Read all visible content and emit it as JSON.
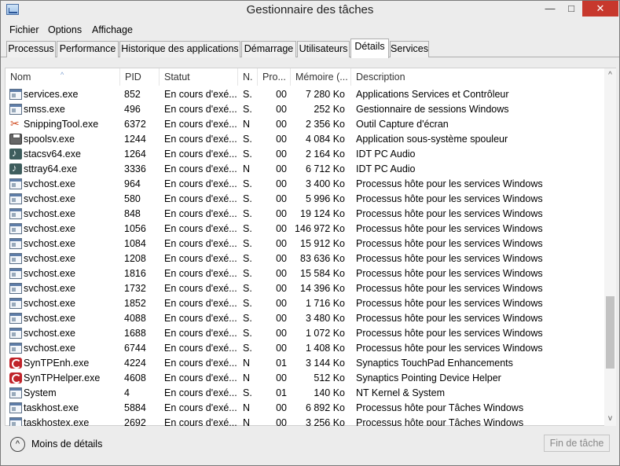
{
  "window": {
    "title": "Gestionnaire des tâches",
    "min_glyph": "—",
    "max_glyph": "□",
    "close_glyph": "✕"
  },
  "menu": [
    "Fichier",
    "Options",
    "Affichage"
  ],
  "tabs": [
    "Processus",
    "Performance",
    "Historique des applications",
    "Démarrage",
    "Utilisateurs",
    "Détails",
    "Services"
  ],
  "active_tab": "Détails",
  "columns": [
    "Nom",
    "PID",
    "Statut",
    "N.",
    "Pro...",
    "Mémoire (...",
    "Description"
  ],
  "sort_glyph": "^",
  "rows": [
    {
      "icon": "window-icon",
      "name": "services.exe",
      "pid": "852",
      "status": "En cours d'exé...",
      "n": "S.",
      "pro": "00",
      "mem": "7 280 Ko",
      "desc": "Applications Services et Contrôleur"
    },
    {
      "icon": "window-icon",
      "name": "smss.exe",
      "pid": "496",
      "status": "En cours d'exé...",
      "n": "S.",
      "pro": "00",
      "mem": "252 Ko",
      "desc": "Gestionnaire de sessions Windows"
    },
    {
      "icon": "scissors-icon",
      "name": "SnippingTool.exe",
      "pid": "6372",
      "status": "En cours d'exé...",
      "n": "N",
      "pro": "00",
      "mem": "2 356 Ko",
      "desc": "Outil Capture d'écran"
    },
    {
      "icon": "printer-icon",
      "name": "spoolsv.exe",
      "pid": "1244",
      "status": "En cours d'exé...",
      "n": "S.",
      "pro": "00",
      "mem": "4 084 Ko",
      "desc": "Application sous-système spouleur"
    },
    {
      "icon": "audio-icon",
      "name": "stacsv64.exe",
      "pid": "1264",
      "status": "En cours d'exé...",
      "n": "S.",
      "pro": "00",
      "mem": "2 164 Ko",
      "desc": "IDT PC Audio"
    },
    {
      "icon": "audio-icon",
      "name": "sttray64.exe",
      "pid": "3336",
      "status": "En cours d'exé...",
      "n": "N",
      "pro": "00",
      "mem": "6 712 Ko",
      "desc": "IDT PC Audio"
    },
    {
      "icon": "window-icon",
      "name": "svchost.exe",
      "pid": "964",
      "status": "En cours d'exé...",
      "n": "S.",
      "pro": "00",
      "mem": "3 400 Ko",
      "desc": "Processus hôte pour les services Windows"
    },
    {
      "icon": "window-icon",
      "name": "svchost.exe",
      "pid": "580",
      "status": "En cours d'exé...",
      "n": "S.",
      "pro": "00",
      "mem": "5 996 Ko",
      "desc": "Processus hôte pour les services Windows"
    },
    {
      "icon": "window-icon",
      "name": "svchost.exe",
      "pid": "848",
      "status": "En cours d'exé...",
      "n": "S.",
      "pro": "00",
      "mem": "19 124 Ko",
      "desc": "Processus hôte pour les services Windows"
    },
    {
      "icon": "window-icon",
      "name": "svchost.exe",
      "pid": "1056",
      "status": "En cours d'exé...",
      "n": "S.",
      "pro": "00",
      "mem": "146 972 Ko",
      "desc": "Processus hôte pour les services Windows"
    },
    {
      "icon": "window-icon",
      "name": "svchost.exe",
      "pid": "1084",
      "status": "En cours d'exé...",
      "n": "S.",
      "pro": "00",
      "mem": "15 912 Ko",
      "desc": "Processus hôte pour les services Windows"
    },
    {
      "icon": "window-icon",
      "name": "svchost.exe",
      "pid": "1208",
      "status": "En cours d'exé...",
      "n": "S.",
      "pro": "00",
      "mem": "83 636 Ko",
      "desc": "Processus hôte pour les services Windows"
    },
    {
      "icon": "window-icon",
      "name": "svchost.exe",
      "pid": "1816",
      "status": "En cours d'exé...",
      "n": "S.",
      "pro": "00",
      "mem": "15 584 Ko",
      "desc": "Processus hôte pour les services Windows"
    },
    {
      "icon": "window-icon",
      "name": "svchost.exe",
      "pid": "1732",
      "status": "En cours d'exé...",
      "n": "S.",
      "pro": "00",
      "mem": "14 396 Ko",
      "desc": "Processus hôte pour les services Windows"
    },
    {
      "icon": "window-icon",
      "name": "svchost.exe",
      "pid": "1852",
      "status": "En cours d'exé...",
      "n": "S.",
      "pro": "00",
      "mem": "1 716 Ko",
      "desc": "Processus hôte pour les services Windows"
    },
    {
      "icon": "window-icon",
      "name": "svchost.exe",
      "pid": "4088",
      "status": "En cours d'exé...",
      "n": "S.",
      "pro": "00",
      "mem": "3 480 Ko",
      "desc": "Processus hôte pour les services Windows"
    },
    {
      "icon": "window-icon",
      "name": "svchost.exe",
      "pid": "1688",
      "status": "En cours d'exé...",
      "n": "S.",
      "pro": "00",
      "mem": "1 072 Ko",
      "desc": "Processus hôte pour les services Windows"
    },
    {
      "icon": "window-icon",
      "name": "svchost.exe",
      "pid": "6744",
      "status": "En cours d'exé...",
      "n": "S.",
      "pro": "00",
      "mem": "1 408 Ko",
      "desc": "Processus hôte pour les services Windows"
    },
    {
      "icon": "synaptics-icon",
      "name": "SynTPEnh.exe",
      "pid": "4224",
      "status": "En cours d'exé...",
      "n": "N",
      "pro": "01",
      "mem": "3 144 Ko",
      "desc": "Synaptics TouchPad Enhancements"
    },
    {
      "icon": "synaptics-icon",
      "name": "SynTPHelper.exe",
      "pid": "4608",
      "status": "En cours d'exé...",
      "n": "N",
      "pro": "00",
      "mem": "512 Ko",
      "desc": "Synaptics Pointing Device Helper"
    },
    {
      "icon": "window-icon",
      "name": "System",
      "pid": "4",
      "status": "En cours d'exé...",
      "n": "S.",
      "pro": "01",
      "mem": "140 Ko",
      "desc": "NT Kernel & System"
    },
    {
      "icon": "window-icon",
      "name": "taskhost.exe",
      "pid": "5884",
      "status": "En cours d'exé...",
      "n": "N",
      "pro": "00",
      "mem": "6 892 Ko",
      "desc": "Processus hôte pour Tâches Windows"
    },
    {
      "icon": "window-icon",
      "name": "taskhostex.exe",
      "pid": "2692",
      "status": "En cours d'exé...",
      "n": "N",
      "pro": "00",
      "mem": "3 256 Ko",
      "desc": "Processus hôte pour Tâches Windows"
    }
  ],
  "scroll": {
    "up_glyph": "^",
    "down_glyph": "v"
  },
  "footer": {
    "chevron_glyph": "^",
    "less_details": "Moins de détails",
    "end_task": "Fin de tâche"
  }
}
